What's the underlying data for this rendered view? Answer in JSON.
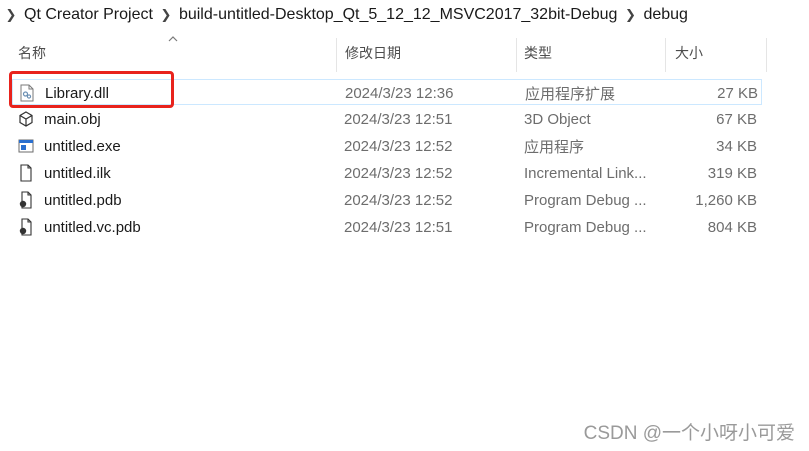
{
  "breadcrumb": {
    "items": [
      "Qt Creator Project",
      "build-untitled-Desktop_Qt_5_12_12_MSVC2017_32bit-Debug",
      "debug"
    ]
  },
  "columns": {
    "name": "名称",
    "date": "修改日期",
    "type": "类型",
    "size": "大小"
  },
  "files": [
    {
      "name": "Library.dll",
      "date": "2024/3/23 12:36",
      "type": "应用程序扩展",
      "size": "27 KB",
      "icon": "dll-file-icon"
    },
    {
      "name": "main.obj",
      "date": "2024/3/23 12:51",
      "type": "3D Object",
      "size": "67 KB",
      "icon": "3d-object-icon"
    },
    {
      "name": "untitled.exe",
      "date": "2024/3/23 12:52",
      "type": "应用程序",
      "size": "34 KB",
      "icon": "exe-file-icon"
    },
    {
      "name": "untitled.ilk",
      "date": "2024/3/23 12:52",
      "type": "Incremental Link...",
      "size": "319 KB",
      "icon": "generic-file-icon"
    },
    {
      "name": "untitled.pdb",
      "date": "2024/3/23 12:52",
      "type": "Program Debug ...",
      "size": "1,260 KB",
      "icon": "pdb-file-icon"
    },
    {
      "name": "untitled.vc.pdb",
      "date": "2024/3/23 12:51",
      "type": "Program Debug ...",
      "size": "804 KB",
      "icon": "pdb-file-icon"
    }
  ],
  "watermark": "CSDN @一个小呀小可爱",
  "colors": {
    "highlight": "#e8231d",
    "selection_border": "#cce8ff",
    "secondary_text": "#6d6d6d"
  }
}
